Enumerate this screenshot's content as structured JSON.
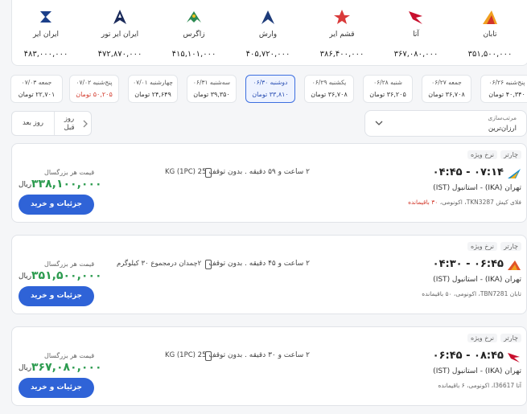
{
  "airlines": [
    {
      "name": "تابان",
      "price": "۳۵۱,۵۰۰,۰۰۰",
      "icon": "taban-logo"
    },
    {
      "name": "آتا",
      "price": "۳۶۷,۰۸۰,۰۰۰",
      "icon": "ata-logo"
    },
    {
      "name": "قشم ایر",
      "price": "۳۸۶,۴۰۰,۰۰۰",
      "icon": "qeshm-air-logo"
    },
    {
      "name": "وارش",
      "price": "۴۰۵,۷۲۰,۰۰۰",
      "icon": "varesh-logo"
    },
    {
      "name": "زاگرس",
      "price": "۴۱۵,۱۰۱,۰۰۰",
      "icon": "zagros-logo"
    },
    {
      "name": "ایران ایر تور",
      "price": "۴۷۲,۸۷۰,۰۰۰",
      "icon": "iran-airtour-logo"
    },
    {
      "name": "ایران ایر",
      "price": "۴۸۳,۰۰۰,۰۰۰",
      "icon": "iran-air-logo"
    }
  ],
  "dates": [
    {
      "day": "پنج‌شنبه ۰۶/۲۶",
      "price": "۴۰,۳۴۰ تومان",
      "low": false
    },
    {
      "day": "جمعه ۰۶/۲۷",
      "price": "۳۶,۷۰۸ تومان",
      "low": false
    },
    {
      "day": "شنبه ۰۶/۲۸",
      "price": "۳۶,۲۰۵ تومان",
      "low": false
    },
    {
      "day": "یکشنبه ۰۶/۲۹",
      "price": "۳۶,۷۰۸ تومان",
      "low": false
    },
    {
      "day": "دوشنبه ۰۶/۳۰",
      "price": "۳۳,۸۱۰ تومان",
      "low": false,
      "selected": true
    },
    {
      "day": "سه‌شنبه ۰۶/۳۱",
      "price": "۳۹,۳۵۰ تومان",
      "low": false
    },
    {
      "day": "چهارشنبه ۰۷/۰۱",
      "price": "۲۴,۶۴۹ تومان",
      "low": false
    },
    {
      "day": "پنج‌شنبه ۰۷/۰۲",
      "price": "۵۰,۲۰۵ تومان",
      "low": true
    },
    {
      "day": "جمعه ۰۷/۰۳",
      "price": "۲۲,۷۰۱ تومان",
      "low": false
    }
  ],
  "nav": {
    "prev_label_1": "روز",
    "prev_label_2": "قبل",
    "next_label": "روز بعد"
  },
  "sort": {
    "title": "مرتب‌سازی",
    "value": "ارزان‌ترین"
  },
  "flights": [
    {
      "type_tag": "چارتر",
      "fare_tag": "نرخ ویژه",
      "times": "۰۴:۴۵ - ۰۷:۱۴",
      "route": "تهران (IKA) - استانبول (IST)",
      "meta_main": "فلای کیش TKN3287، اکونومی، ",
      "meta_seats": "۳۰ باقیمانده",
      "duration": "۲ ساعت و ۵۹ دقیقه . بدون توقف",
      "baggage": "25 KG (1PC)",
      "price_label": "قیمت هر بزرگسال",
      "price": "۳۳۸,۱۰۰,۰۰۰",
      "currency": "ریال",
      "button": "جزئیات و خرید",
      "logo": "fly-kish-logo",
      "logo_color": "#1c8fc7"
    },
    {
      "type_tag": "چارتر",
      "fare_tag": "نرخ ویژه",
      "times": "۰۴:۳۰ - ۰۶:۴۵",
      "route": "تهران (IKA) - استانبول (IST)",
      "meta_main": "تابان TBN7281، اکونومی، ۵۰ باقیمانده",
      "meta_seats": "",
      "duration": "۲ ساعت و ۴۵ دقیقه . بدون توقف",
      "baggage": "۲چمدان درمجموع ۳۰ کیلوگرم",
      "price_label": "قیمت هر بزرگسال",
      "price": "۳۵۱,۵۰۰,۰۰۰",
      "currency": "ریال",
      "button": "جزئیات و خرید",
      "logo": "taban-logo",
      "logo_color": "#e0532a"
    },
    {
      "type_tag": "چارتر",
      "fare_tag": "نرخ ویژه",
      "times": "۰۶:۴۵ - ۰۸:۴۵",
      "route": "تهران (IKA) - استانبول (IST)",
      "meta_main": "آتا I36617، اکونومی، ۶ باقیمانده",
      "meta_seats": "",
      "duration": "۲ ساعت و ۳۰ دقیقه . بدون توقف",
      "baggage": "25 KG (1PC)",
      "price_label": "قیمت هر بزرگسال",
      "price": "۳۶۷,۰۸۰,۰۰۰",
      "currency": "ریال",
      "button": "جزئیات و خرید",
      "logo": "ata-logo",
      "logo_color": "#c8102e"
    }
  ]
}
